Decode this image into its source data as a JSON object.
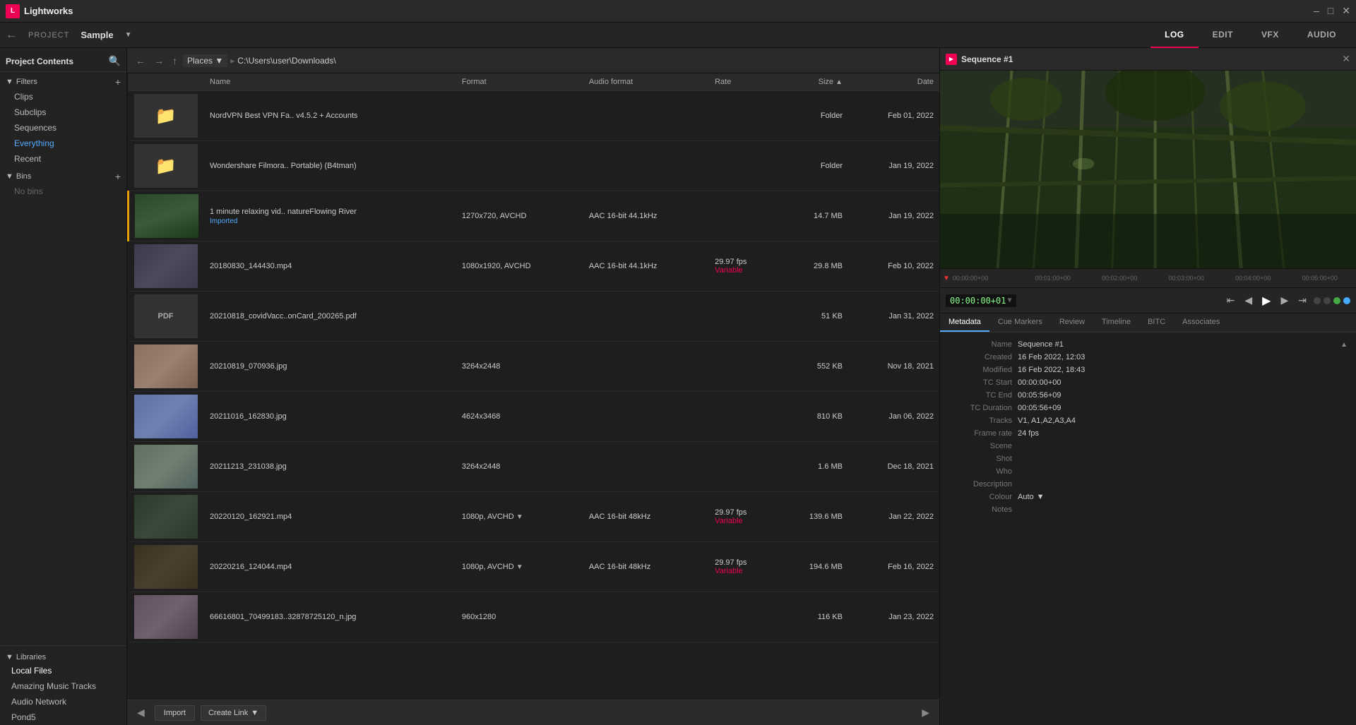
{
  "titlebar": {
    "app_name": "Lightworks",
    "project_label": "PROJECT",
    "project_name": "Sample"
  },
  "tabs": [
    {
      "id": "log",
      "label": "LOG",
      "active": true
    },
    {
      "id": "edit",
      "label": "EDIT",
      "active": false
    },
    {
      "id": "vfx",
      "label": "VFX",
      "active": false
    },
    {
      "id": "audio",
      "label": "AUDIO",
      "active": false
    }
  ],
  "sidebar": {
    "header": "Project Contents",
    "filters_label": "Filters",
    "items": [
      {
        "id": "clips",
        "label": "Clips"
      },
      {
        "id": "subclips",
        "label": "Subclips"
      },
      {
        "id": "sequences",
        "label": "Sequences"
      },
      {
        "id": "everything",
        "label": "Everything",
        "active": true
      },
      {
        "id": "recent",
        "label": "Recent"
      }
    ],
    "bins_label": "Bins",
    "no_bins": "No bins",
    "libraries_label": "Libraries",
    "library_items": [
      {
        "id": "local-files",
        "label": "Local Files",
        "active": true
      },
      {
        "id": "amazing-music",
        "label": "Amazing Music Tracks"
      },
      {
        "id": "audio-network",
        "label": "Audio Network"
      },
      {
        "id": "pond5",
        "label": "Pond5"
      }
    ]
  },
  "browser": {
    "places_label": "Places",
    "path": "C:\\Users\\user\\Downloads\\",
    "columns": {
      "name": "Name",
      "format": "Format",
      "audio_format": "Audio format",
      "rate": "Rate",
      "size": "Size",
      "date": "Date"
    },
    "files": [
      {
        "id": 1,
        "thumb_type": "folder",
        "name": "NordVPN Best VPN Fa.. v4.5.2 + Accounts",
        "format": "",
        "audio_format": "",
        "rate": "",
        "size": "Folder",
        "date": "Feb 01, 2022"
      },
      {
        "id": 2,
        "thumb_type": "folder",
        "name": "Wondershare Filmora.. Portable) (B4tman)",
        "format": "",
        "audio_format": "",
        "rate": "",
        "size": "Folder",
        "date": "Jan 19, 2022"
      },
      {
        "id": 3,
        "thumb_type": "video",
        "name": "1 minute relaxing vid.. natureFlowing River",
        "sub_label": "Imported",
        "format": "1270x720, AVCHD",
        "audio_format": "AAC 16-bit 44.1kHz",
        "rate": "",
        "size": "14.7 MB",
        "date": "Jan 19, 2022"
      },
      {
        "id": 4,
        "thumb_type": "video_dark",
        "name": "20180830_144430.mp4",
        "format": "1080x1920, AVCHD",
        "audio_format": "AAC 16-bit 44.1kHz",
        "rate": "29.97 fps",
        "rate_note": "Variable",
        "size": "29.8 MB",
        "date": "Feb 10, 2022"
      },
      {
        "id": 5,
        "thumb_type": "pdf",
        "name": "20210818_covidVacc..onCard_200265.pdf",
        "format": "",
        "audio_format": "",
        "rate": "",
        "size": "51 KB",
        "date": "Jan 31, 2022"
      },
      {
        "id": 6,
        "thumb_type": "image",
        "name": "20210819_070936.jpg",
        "format": "3264x2448",
        "audio_format": "",
        "rate": "",
        "size": "552 KB",
        "date": "Nov 18, 2021"
      },
      {
        "id": 7,
        "thumb_type": "image",
        "name": "20211016_162830.jpg",
        "format": "4624x3468",
        "audio_format": "",
        "rate": "",
        "size": "810 KB",
        "date": "Jan 06, 2022"
      },
      {
        "id": 8,
        "thumb_type": "image",
        "name": "20211213_231038.jpg",
        "format": "3264x2448",
        "audio_format": "",
        "rate": "",
        "size": "1.6 MB",
        "date": "Dec 18, 2021"
      },
      {
        "id": 9,
        "thumb_type": "video",
        "name": "20220120_162921.mp4",
        "format": "1080p, AVCHD",
        "audio_format": "AAC 16-bit 48kHz",
        "rate": "29.97 fps",
        "rate_note": "Variable",
        "size": "139.6 MB",
        "date": "Jan 22, 2022"
      },
      {
        "id": 10,
        "thumb_type": "video",
        "name": "20220216_124044.mp4",
        "format": "1080p, AVCHD",
        "audio_format": "AAC 16-bit 48kHz",
        "rate": "29.97 fps",
        "rate_note": "Variable",
        "size": "194.6 MB",
        "date": "Feb 16, 2022"
      },
      {
        "id": 11,
        "thumb_type": "image",
        "name": "66616801_70499183..32878725120_n.jpg",
        "format": "960x1280",
        "audio_format": "",
        "rate": "",
        "size": "116 KB",
        "date": "Jan 23, 2022"
      }
    ],
    "import_btn": "Import",
    "create_link_btn": "Create Link"
  },
  "sequence": {
    "title": "Sequence #1",
    "timeline_marks": [
      "00:00:00+00",
      "00:01:00+00",
      "00:02:00+00",
      "00:03:00+00",
      "00:04:00+00",
      "00:05:00+00"
    ],
    "tc_current": "00:00:00+01",
    "meta_tabs": [
      "Metadata",
      "Cue Markers",
      "Review",
      "Timeline",
      "BITC",
      "Associates"
    ],
    "active_meta_tab": "Metadata",
    "metadata": {
      "name_label": "Name",
      "name_value": "Sequence #1",
      "created_label": "Created",
      "created_value": "16 Feb 2022, 12:03",
      "modified_label": "Modified",
      "modified_value": "16 Feb 2022, 18:43",
      "tc_start_label": "TC Start",
      "tc_start_value": "00:00:00+00",
      "tc_end_label": "TC End",
      "tc_end_value": "00:05:56+09",
      "tc_duration_label": "TC Duration",
      "tc_duration_value": "00:05:56+09",
      "tracks_label": "Tracks",
      "tracks_value": "V1, A1,A2,A3,A4",
      "frame_rate_label": "Frame rate",
      "frame_rate_value": "24 fps",
      "scene_label": "Scene",
      "scene_value": "",
      "shot_label": "Shot",
      "shot_value": "",
      "who_label": "Who",
      "who_value": "",
      "description_label": "Description",
      "description_value": "",
      "colour_label": "Colour",
      "colour_value": "Auto",
      "notes_label": "Notes",
      "notes_value": ""
    }
  }
}
